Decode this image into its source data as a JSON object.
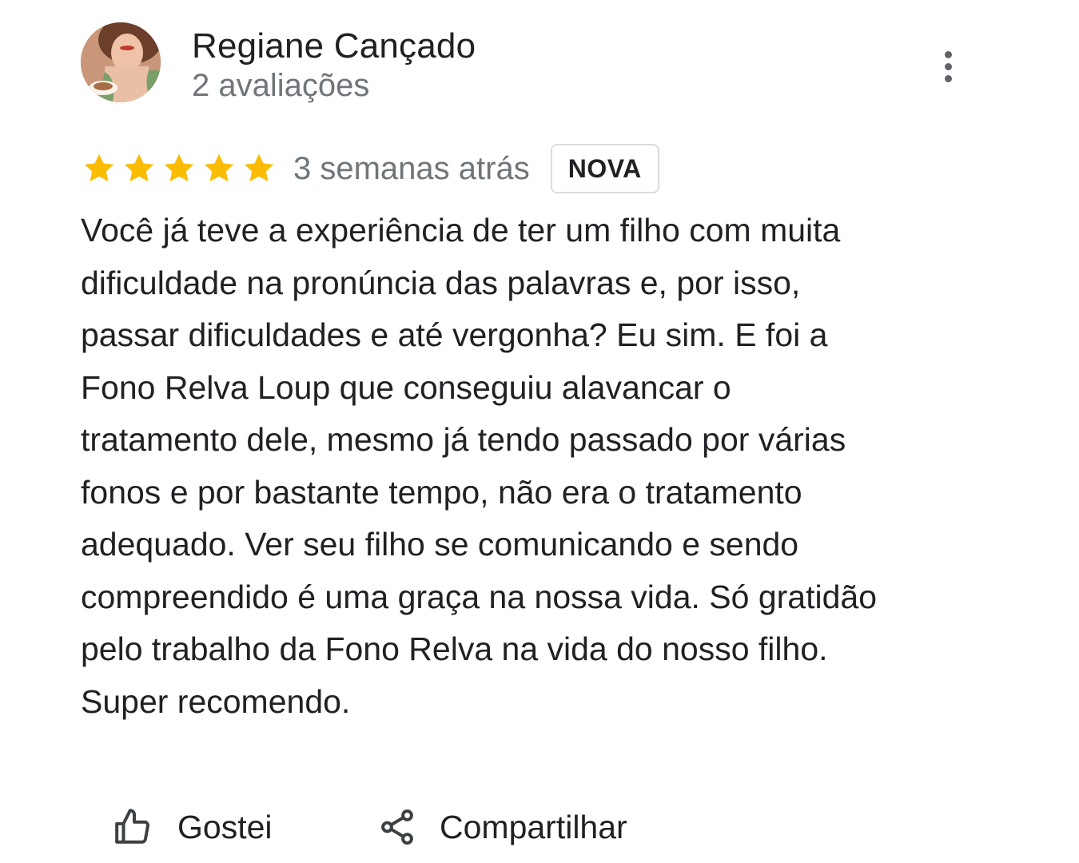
{
  "reviewer": {
    "name": "Regiane Cançado",
    "meta": "2 avaliações"
  },
  "rating": {
    "stars": 5,
    "max_stars": 5,
    "star_color": "#fbbc04",
    "date": "3 semanas atrás",
    "badge": "NOVA"
  },
  "review": {
    "lines": [
      "Você já teve a experiência de ter um filho com muita",
      "dificuldade na pronúncia das palavras e, por isso,",
      "passar dificuldades e até vergonha? Eu sim. E foi a",
      "Fono Relva Loup que conseguiu alavancar o",
      "tratamento dele, mesmo já tendo passado por várias",
      "fonos e por bastante tempo, não era o tratamento",
      "adequado. Ver seu filho se comunicando e sendo",
      "compreendido é uma graça na nossa vida. Só gratidão",
      "pelo trabalho da Fono Relva na vida do nosso filho.",
      "Super recomendo."
    ]
  },
  "actions": {
    "like_label": "Gostei",
    "share_label": "Compartilhar",
    "like_icon": "thumbs-up-icon",
    "share_icon": "share-icon",
    "more_icon": "more-vert-icon"
  },
  "colors": {
    "text_primary": "#202124",
    "text_secondary": "#70757a",
    "icon": "#5f6368",
    "badge_border": "#dadce0"
  }
}
